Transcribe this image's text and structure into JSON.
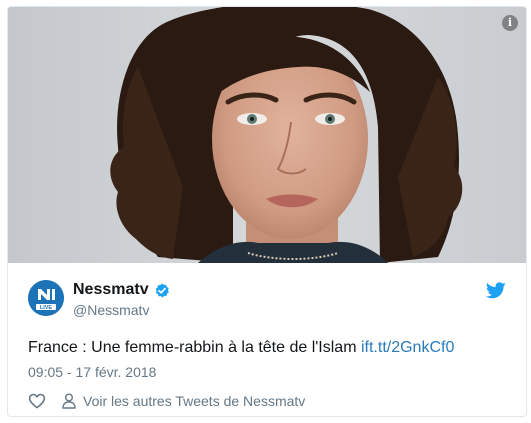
{
  "media": {
    "info_symbol": "i",
    "info_icon": "info-icon"
  },
  "tweet": {
    "author_name": "Nessmatv",
    "author_handle": "@Nessmatv",
    "verified_icon": "verified-badge-icon",
    "brand_icon": "twitter-bird-icon",
    "avatar_text": "LIVE",
    "text": "France : Une femme-rabbin à la tête de l'Islam ",
    "link": "ift.tt/2GnkCf0",
    "timestamp": "09:05 - 17 févr. 2018",
    "like_icon": "heart-icon",
    "more_tweets_label": "Voir les autres Tweets de Nessmatv",
    "more_tweets_icon": "person-icon"
  },
  "colors": {
    "link": "#2b7bb9",
    "text": "#14171a",
    "secondary": "#657786",
    "twitter_blue": "#1da1f2",
    "border": "#e1e8ed"
  }
}
